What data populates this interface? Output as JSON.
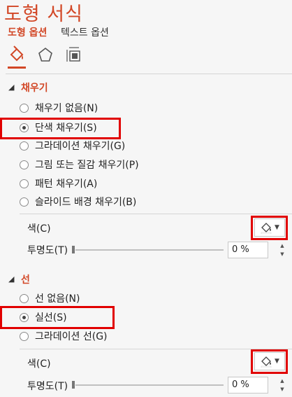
{
  "panel": {
    "title": "도형 서식",
    "tabs": [
      {
        "label": "도형 옵션",
        "active": true
      },
      {
        "label": "텍스트 옵션",
        "active": false
      }
    ],
    "icon_tabs": [
      "fill-line-icon",
      "effects-pentagon-icon",
      "size-properties-icon"
    ]
  },
  "fill": {
    "section_title": "채우기",
    "options": [
      {
        "label": "채우기 없음(N)",
        "selected": false
      },
      {
        "label": "단색 채우기(S)",
        "selected": true
      },
      {
        "label": "그라데이션 채우기(G)",
        "selected": false
      },
      {
        "label": "그림 또는 질감 채우기(P)",
        "selected": false
      },
      {
        "label": "패턴 채우기(A)",
        "selected": false
      },
      {
        "label": "슬라이드 배경 채우기(B)",
        "selected": false
      }
    ],
    "color_label": "색(C)",
    "transparency_label": "투명도(T)",
    "transparency_value": "0 %"
  },
  "line": {
    "section_title": "선",
    "options": [
      {
        "label": "선 없음(N)",
        "selected": false
      },
      {
        "label": "실선(S)",
        "selected": true
      },
      {
        "label": "그라데이션 선(G)",
        "selected": false
      }
    ],
    "color_label": "색(C)",
    "transparency_label": "투명도(T)",
    "transparency_value": "0 %"
  },
  "colors": {
    "accent": "#d24726",
    "highlight": "#e10000",
    "background": "#f6f6f6"
  }
}
